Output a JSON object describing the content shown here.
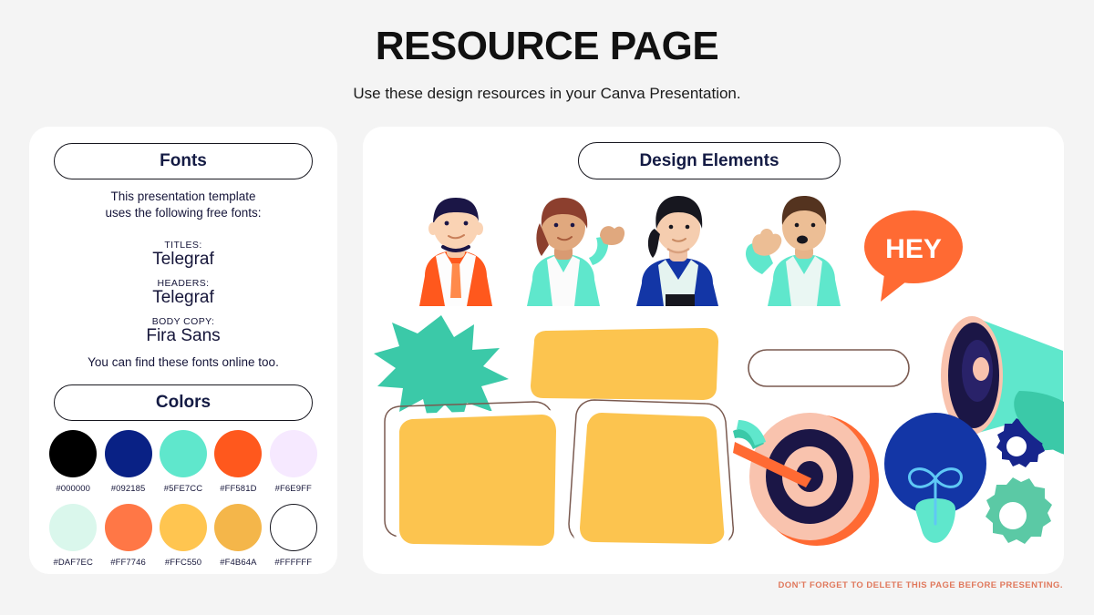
{
  "header": {
    "title": "RESOURCE PAGE",
    "subtitle": "Use these design resources in your Canva Presentation."
  },
  "fonts_panel": {
    "heading": "Fonts",
    "intro_line1": "This presentation template",
    "intro_line2": "uses the following free fonts:",
    "entries": [
      {
        "label": "TITLES:",
        "name": "Telegraf"
      },
      {
        "label": "HEADERS:",
        "name": "Telegraf"
      },
      {
        "label": "BODY COPY:",
        "name": "Fira Sans"
      }
    ],
    "outro": "You can find these fonts online too."
  },
  "colors_panel": {
    "heading": "Colors",
    "swatches": [
      {
        "hex": "#000000",
        "label": "#000000",
        "outlined": false
      },
      {
        "hex": "#092185",
        "label": "#092185",
        "outlined": false
      },
      {
        "hex": "#5FE7CC",
        "label": "#5FE7CC",
        "outlined": false
      },
      {
        "hex": "#FF581D",
        "label": "#FF581D",
        "outlined": false
      },
      {
        "hex": "#F6E9FF",
        "label": "#F6E9FF",
        "outlined": false
      },
      {
        "hex": "#DAF7EC",
        "label": "#DAF7EC",
        "outlined": false
      },
      {
        "hex": "#FF7746",
        "label": "#FF7746",
        "outlined": false
      },
      {
        "hex": "#FFC550",
        "label": "#FFC550",
        "outlined": false
      },
      {
        "hex": "#F4B64A",
        "label": "#F4B64A",
        "outlined": false
      },
      {
        "hex": "#FFFFFF",
        "label": "#FFFFFF",
        "outlined": true
      }
    ]
  },
  "elements_panel": {
    "heading": "Design Elements",
    "speech_bubble_text": "HEY",
    "items": [
      "character-orange-jacket",
      "character-mint-jacket-waving",
      "character-blue-cardigan",
      "character-mint-shirt-gesturing",
      "speech-bubble-hey",
      "starburst-teal",
      "banner-yellow-rounded",
      "pill-outline",
      "megaphone",
      "card-yellow-left",
      "card-yellow-right",
      "target-with-arrow",
      "lightbulb",
      "gear-navy",
      "gear-mint"
    ]
  },
  "footer": {
    "note": "DON'T FORGET TO DELETE THIS PAGE BEFORE PRESENTING."
  },
  "palette": {
    "page_bg": "#F4F4F4",
    "card_bg": "#FFFFFF",
    "navy": "#141B44",
    "deep_navy": "#1B1646",
    "blue": "#1336A6",
    "mint": "#5FE7CC",
    "teal": "#3BC9A8",
    "orange": "#FF581D",
    "orange_light": "#FF7746",
    "yellow": "#FBC košt",
    "yellow_main": "#FCC44F",
    "peach": "#F9C3AE",
    "footer_text": "#E0785C"
  }
}
